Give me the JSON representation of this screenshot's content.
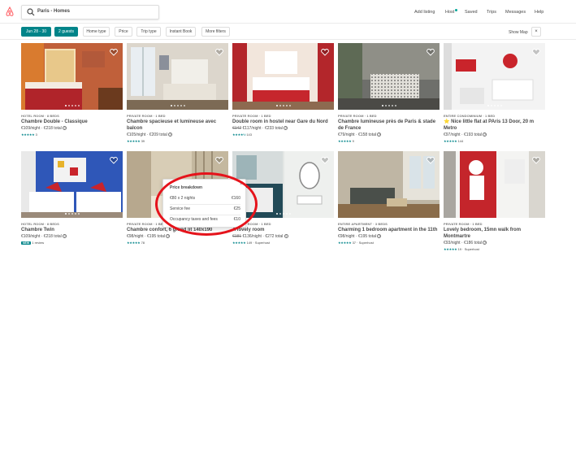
{
  "header": {
    "search_value": "Paris - Homes",
    "nav": [
      "Add listing",
      "Host",
      "Saved",
      "Trips",
      "Messages",
      "Help"
    ]
  },
  "filters": {
    "pills": [
      "Jun 28 - 30",
      "2 guests",
      "Home type",
      "Price",
      "Trip type",
      "Instant Book",
      "More filters"
    ],
    "show_map": "Show Map",
    "close": "×"
  },
  "colors": {
    "brand": "#ff5a5f",
    "accent": "#008489",
    "alert": "#e5131b"
  },
  "listings": [
    {
      "kind": "HOTEL ROOM · 8 BEDS",
      "title": "Chambre Double - Classique",
      "price": "€109/night · €218 total",
      "stars": "★★★★★",
      "reviews": "3"
    },
    {
      "kind": "PRIVATE ROOM · 1 BED",
      "title": "Chambre spacieuse et lumineuse avec balcon",
      "price": "€105/night · €209 total",
      "stars": "★★★★★",
      "reviews": "39"
    },
    {
      "kind": "PRIVATE ROOM · 1 BED",
      "title": "Double room in hostel near Gare du Nord",
      "price_old": "€142",
      "price": "€117/night · €233 total",
      "stars": "★★★★½",
      "reviews": "143"
    },
    {
      "kind": "PRIVATE ROOM · 1 BED",
      "title": "Chambre lumineuse près de Paris & stade de France",
      "price": "€79/night · €158 total",
      "stars": "★★★★★",
      "reviews": "9"
    },
    {
      "kind": "ENTIRE CONDOMINIUM · 1 BED",
      "title": "⭐ Nice little flat at PAris 13 Door, 20 m Metro",
      "price": "€97/night · €193 total",
      "stars": "★★★★★",
      "reviews": "144"
    },
    {
      "kind": "HOTEL ROOM · 8 BEDS",
      "title": "Chambre Twin",
      "price": "€109/night · €218 total",
      "badge": "NEW",
      "badge_text": "1 review"
    },
    {
      "kind": "PRIVATE ROOM · 1 BED",
      "title": "Chambre confort, 6 grand lit 140x190",
      "price": "€98/night · €195 total",
      "stars": "★★★★★",
      "reviews": "78"
    },
    {
      "kind": "PRIVATE ROOM · 1 BED",
      "title": "A lovely room",
      "price_old": "€181",
      "price": "€136/night · €272 total",
      "stars": "★★★★★",
      "reviews": "149 · Superhost"
    },
    {
      "kind": "ENTIRE APARTMENT · 3 BEDS",
      "title": "Charming 1 bedroom apartment in the 11th",
      "price": "€98/night · €195 total",
      "stars": "★★★★★",
      "reviews": "37 · Superhost"
    },
    {
      "kind": "PRIVATE ROOM · 1 BED",
      "title": "Lovely bedroom, 15mn walk from Montmartre",
      "price": "€93/night · €186 total",
      "stars": "★★★★★",
      "reviews": "19 · Superhost"
    }
  ],
  "price_breakdown": {
    "title": "Price breakdown",
    "close": "×",
    "rows": [
      {
        "label": "€80 x 2 nights",
        "amount": "€160"
      },
      {
        "label": "Service fee",
        "amount": "€25"
      },
      {
        "label": "Occupancy taxes and fees",
        "amount": "€10"
      }
    ]
  }
}
